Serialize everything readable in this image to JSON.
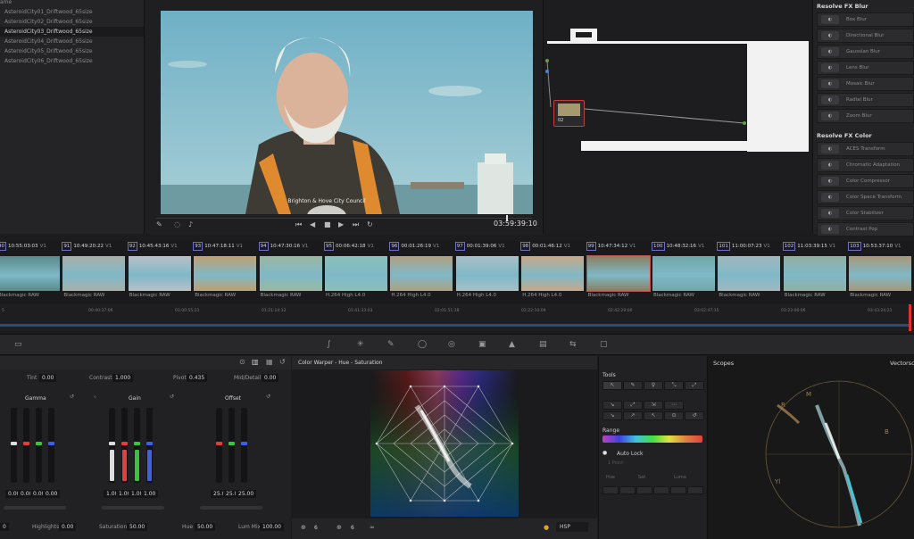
{
  "media_pool": {
    "header": "ame",
    "items": [
      {
        "label": "AsteroidCity01_Driftwood_65size"
      },
      {
        "label": "AsteroidCity02_Driftwood_65size"
      },
      {
        "label": "AsteroidCity03_Driftwood_65size"
      },
      {
        "label": "AsteroidCity04_Driftwood_65size"
      },
      {
        "label": "AsteroidCity05_Driftwood_65size"
      },
      {
        "label": "AsteroidCity06_Driftwood_65size"
      }
    ],
    "selected_index": 2
  },
  "viewer": {
    "timecode": "03:59:39:10",
    "poster_text": "Brighton & Hove City Council"
  },
  "node_editor": {
    "node_label": "02"
  },
  "fx_library": {
    "sections": [
      {
        "title": "Resolve FX Blur",
        "items": [
          "Box Blur",
          "Directional Blur",
          "Gaussian Blur",
          "Lens Blur",
          "Mosaic Blur",
          "Radial Blur",
          "Zoom Blur"
        ]
      },
      {
        "title": "Resolve FX Color",
        "items": [
          "ACES Transform",
          "Chromatic Adaptation",
          "Color Compressor",
          "Color Space Transform",
          "Color Stabilizer",
          "Contrast Pop"
        ]
      }
    ]
  },
  "clips": [
    {
      "num": "90",
      "track": "V1",
      "tc": "10:55:03:03",
      "codec": "Blackmagic RAW",
      "color": "#5a8a8a"
    },
    {
      "num": "91",
      "track": "V1",
      "tc": "10:49:20:22",
      "codec": "Blackmagic RAW",
      "color": "#a8b0a8"
    },
    {
      "num": "92",
      "track": "V1",
      "tc": "10:45:43:16",
      "codec": "Blackmagic RAW",
      "color": "#b8c0c8"
    },
    {
      "num": "93",
      "track": "V1",
      "tc": "10:47:18:11",
      "codec": "Blackmagic RAW",
      "color": "#c0a070"
    },
    {
      "num": "94",
      "track": "V1",
      "tc": "10:47:30:16",
      "codec": "Blackmagic RAW",
      "color": "#9ab8a0"
    },
    {
      "num": "95",
      "track": "V1",
      "tc": "00:06:42:18",
      "codec": "H.264 High L4.0",
      "color": "#8ac0b8"
    },
    {
      "num": "96",
      "track": "V1",
      "tc": "00:01:26:19",
      "codec": "H.264 High L4.0",
      "color": "#b0a080"
    },
    {
      "num": "97",
      "track": "V1",
      "tc": "00:01:39:06",
      "codec": "H.264 High L4.0",
      "color": "#a8c0c8"
    },
    {
      "num": "98",
      "track": "V1",
      "tc": "00:01:46:12",
      "codec": "H.264 High L4.0",
      "color": "#c8a888"
    },
    {
      "num": "99",
      "track": "V1",
      "tc": "10:47:34:12",
      "codec": "Blackmagic RAW",
      "color": "#8a8060"
    },
    {
      "num": "100",
      "track": "V1",
      "tc": "10:48:32:16",
      "codec": "Blackmagic RAW",
      "color": "#70a8a8"
    },
    {
      "num": "101",
      "track": "V1",
      "tc": "11:00:07:23",
      "codec": "Blackmagic RAW",
      "color": "#a0b8c0"
    },
    {
      "num": "102",
      "track": "V1",
      "tc": "11:03:39:15",
      "codec": "Blackmagic RAW",
      "color": "#90b0a0"
    },
    {
      "num": "103",
      "track": "V1",
      "tc": "10:53:37:10",
      "codec": "Blackmagic RAW",
      "color": "#a89878"
    }
  ],
  "selected_clip_index": 9,
  "ruler_ticks": [
    "5",
    "00:40:37:06",
    "01:00:55:21",
    "01:21:14:12",
    "01:41:33:03",
    "02:01:51:18",
    "02:22:10:09",
    "02:42:29:00",
    "03:02:47:15",
    "03:23:06:06",
    "03:43:24:21"
  ],
  "wheels_panel": {
    "tint_label": "Tint",
    "tint_value": "0.00",
    "contrast_label": "Contrast",
    "contrast_value": "1.000",
    "pivot_label": "Pivot",
    "pivot_value": "0.435",
    "middetail_label": "Mid/Detail",
    "middetail_value": "0.00",
    "gamma_title": "Gamma",
    "gain_title": "Gain",
    "offset_title": "Offset",
    "gamma_values": [
      "0.00",
      "0.00",
      "0.00",
      "0.00"
    ],
    "gain_values": [
      "1.00",
      "1.00",
      "1.00",
      "1.00"
    ],
    "offset_values": [
      "25.00",
      "25.00",
      "25.00"
    ],
    "bottom": {
      "first_value": "0",
      "highlights_label": "Highlights",
      "highlights_value": "0.00",
      "saturation_label": "Saturation",
      "saturation_value": "50.00",
      "hue_label": "Hue",
      "hue_value": "50.00",
      "lummix_label": "Lum Mix",
      "lummix_value": "100.00"
    }
  },
  "warper": {
    "title": "Color Warper - Hue - Saturation",
    "grid_a": "6",
    "grid_b": "6",
    "mode": "HSP"
  },
  "tools_panel": {
    "title": "Tools",
    "range_label": "Range",
    "autolock_label": "Auto Lock",
    "point_label": "1 Point",
    "hue_label": "Hue",
    "sat_label": "Sat",
    "luma_label": "Luma"
  },
  "scopes": {
    "title": "Scopes",
    "mode": "Vectorsc"
  }
}
